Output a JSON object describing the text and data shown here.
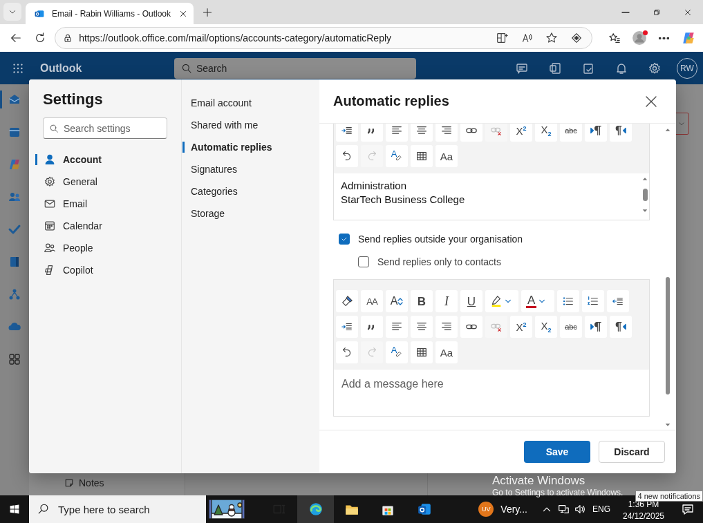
{
  "browser": {
    "tab": {
      "title": "Email - Rabin Williams - Outlook",
      "selected": true
    },
    "address": "https://outlook.office.com/mail/options/accounts-category/automaticReply"
  },
  "outlook_header": {
    "app_name": "Outlook",
    "search": {
      "placeholder": "Search"
    },
    "avatar": "RW"
  },
  "app_rail": [
    {
      "selected": true
    },
    {
      "selected": false
    },
    {
      "selected": false
    },
    {
      "selected": false
    },
    {
      "selected": false
    },
    {
      "selected": false
    },
    {
      "selected": false
    },
    {
      "selected": false
    },
    {
      "selected": false
    }
  ],
  "folder_pane": {
    "items": [
      {
        "label": "Notes"
      }
    ]
  },
  "settings": {
    "title": "Settings",
    "search": {
      "placeholder": "Search settings"
    },
    "categories": [
      {
        "label": "Account",
        "selected": true
      },
      {
        "label": "General",
        "selected": false
      },
      {
        "label": "Email",
        "selected": false
      },
      {
        "label": "Calendar",
        "selected": false
      },
      {
        "label": "People",
        "selected": false
      },
      {
        "label": "Copilot",
        "selected": false
      }
    ],
    "subcategories": [
      {
        "label": "Email account",
        "selected": false
      },
      {
        "label": "Shared with me",
        "selected": false
      },
      {
        "label": "Automatic replies",
        "selected": true
      },
      {
        "label": "Signatures",
        "selected": false
      },
      {
        "label": "Categories",
        "selected": false
      },
      {
        "label": "Storage",
        "selected": false
      }
    ]
  },
  "panel": {
    "title": "Automatic replies",
    "editors": [
      {
        "toolbar": [
          [
            {
              "kind": "indent",
              "disabled": false
            },
            {
              "kind": "quote",
              "disabled": false
            },
            {
              "kind": "align_left",
              "disabled": false
            },
            {
              "kind": "align_center",
              "disabled": false
            },
            {
              "kind": "align_right",
              "disabled": false
            },
            {
              "kind": "link",
              "disabled": false
            },
            {
              "kind": "unlink",
              "disabled": true
            },
            {
              "kind": "superscript",
              "label": "X$^{2}$",
              "disabled": false
            },
            {
              "kind": "subscript",
              "label": "X$_{2}$",
              "disabled": false
            },
            {
              "kind": "strikethrough",
              "label": "abc",
              "disabled": false
            },
            {
              "kind": "ltr",
              "disabled": false
            },
            {
              "kind": "rtl",
              "disabled": false
            }
          ],
          [
            {
              "kind": "undo",
              "disabled": false
            },
            {
              "kind": "redo",
              "disabled": true
            },
            {
              "kind": "clear_format",
              "label": "A",
              "disabled": false
            },
            {
              "kind": "table",
              "disabled": false
            },
            {
              "kind": "font_style",
              "label": "Aa",
              "disabled": false
            }
          ]
        ],
        "lines": [
          "Administration",
          "StarTech Business College"
        ]
      },
      {
        "toolbar": [
          [
            {
              "kind": "format_painter",
              "disabled": false
            },
            {
              "kind": "font_size",
              "label": "AA",
              "disabled": false
            },
            {
              "kind": "grow_font",
              "label": "A",
              "disabled": false
            },
            {
              "kind": "bold",
              "label": "B",
              "disabled": false
            },
            {
              "kind": "italic",
              "label": "I",
              "disabled": false
            },
            {
              "kind": "underline",
              "label": "U",
              "disabled": false
            },
            {
              "kind": "highlight",
              "disabled": false
            },
            {
              "kind": "font_color",
              "label": "A",
              "disabled": false
            },
            {
              "kind": "bullets",
              "disabled": false
            },
            {
              "kind": "numbering",
              "disabled": false
            },
            {
              "kind": "outdent",
              "disabled": false
            }
          ],
          [
            {
              "kind": "indent",
              "disabled": false
            },
            {
              "kind": "quote",
              "disabled": false
            },
            {
              "kind": "align_left",
              "disabled": false
            },
            {
              "kind": "align_center",
              "disabled": false
            },
            {
              "kind": "align_right",
              "disabled": false
            },
            {
              "kind": "link",
              "disabled": false
            },
            {
              "kind": "unlink",
              "disabled": true
            },
            {
              "kind": "superscript",
              "label": "X$^{2}$",
              "disabled": false
            },
            {
              "kind": "subscript",
              "label": "X$_{2}$",
              "disabled": false
            },
            {
              "kind": "strikethrough",
              "label": "abc",
              "disabled": false
            },
            {
              "kind": "ltr",
              "disabled": false
            },
            {
              "kind": "rtl",
              "disabled": false
            }
          ],
          [
            {
              "kind": "undo",
              "disabled": false
            },
            {
              "kind": "redo",
              "disabled": true
            },
            {
              "kind": "clear_format",
              "label": "A",
              "disabled": false
            },
            {
              "kind": "table",
              "disabled": false
            },
            {
              "kind": "font_style",
              "label": "Aa",
              "disabled": false
            }
          ]
        ],
        "placeholder": "Add a message here"
      }
    ],
    "options": [
      {
        "label": "Send replies outside your organisation",
        "checked": true,
        "children": [
          {
            "label": "Send replies only to contacts",
            "checked": false
          }
        ]
      }
    ],
    "buttons": [
      {
        "label": "Save",
        "kind": "primary"
      },
      {
        "label": "Discard",
        "kind": "secondary"
      }
    ]
  },
  "taskbar": {
    "search": {
      "placeholder": "Type here to search"
    },
    "weather": {
      "badge": "UV",
      "text": "Very..."
    },
    "language": "ENG",
    "time": "1:36 PM",
    "date": "24/12/2025",
    "tooltip": "4 new notifications"
  },
  "activation_notice": {
    "title": "Activate Windows",
    "text": "Go to Settings to activate Windows."
  }
}
